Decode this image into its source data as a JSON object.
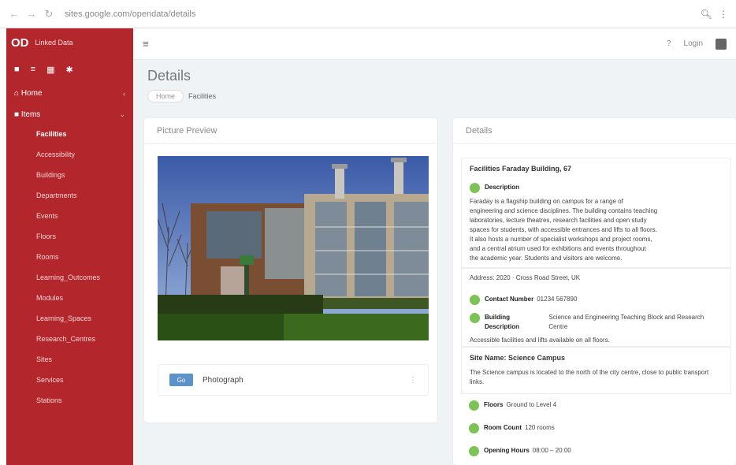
{
  "browser": {
    "url": "sites.google.com/opendata/details",
    "back": "←",
    "forward": "→",
    "reload": "↻",
    "search_icon": "search-icon",
    "menu_icon": "more-icon"
  },
  "brand": {
    "logo": "OD",
    "name": "Linked Data"
  },
  "sidebar": {
    "quick_icons": [
      "home-icon",
      "list-icon",
      "grid-icon",
      "settings-icon"
    ],
    "home_label": "Home",
    "section_label": "Items",
    "items": [
      {
        "label": "Facilities",
        "active": true
      },
      {
        "label": "Accessibility",
        "active": false
      },
      {
        "label": "Buildings",
        "active": false
      },
      {
        "label": "Departments",
        "active": false
      },
      {
        "label": "Events",
        "active": false
      },
      {
        "label": "Floors",
        "active": false
      },
      {
        "label": "Rooms",
        "active": false
      },
      {
        "label": "Learning_Outcomes",
        "active": false
      },
      {
        "label": "Modules",
        "active": false
      },
      {
        "label": "Learning_Spaces",
        "active": false
      },
      {
        "label": "Research_Centres",
        "active": false
      },
      {
        "label": "Sites",
        "active": false
      },
      {
        "label": "Services",
        "active": false
      },
      {
        "label": "Stations",
        "active": false
      }
    ]
  },
  "topbar": {
    "menu_icon": "menu-icon",
    "help_text": "?",
    "login_text": "Login",
    "user_icon": "user-icon"
  },
  "page": {
    "title": "Details",
    "breadcrumb_home": "Home",
    "breadcrumb_current": "Facilities"
  },
  "photo_panel": {
    "heading": "Picture Preview",
    "button_label": "Go",
    "footer_label": "Photograph",
    "more_label": "⋮"
  },
  "details_panel": {
    "heading": "Details",
    "card1": {
      "title": "Facilities Faraday Building, 67",
      "badge_label": "Description",
      "lines": [
        "Faraday is a flagship building on campus for a range of",
        "engineering and science disciplines. The building contains teaching",
        "laboratories, lecture theatres, research facilities and open study",
        "spaces for students, with accessible entrances and lifts to all floors.",
        "It also hosts a number of specialist workshops and project rooms,",
        "and a central atrium used for exhibitions and events throughout",
        "the academic year. Students and visitors are welcome."
      ]
    },
    "card2": {
      "address": "Address: 2020 · Cross Road Street, UK",
      "rows": [
        {
          "label": "Contact Number",
          "text": "01234 567890"
        },
        {
          "label": "Building Description",
          "text": "Science and Engineering Teaching Block and Research Centre"
        }
      ],
      "tail": "Accessible facilities and lifts available on all floors."
    },
    "card3": {
      "title": "Site Name: Science Campus",
      "lines": [
        "The Science campus is located to the north of the city centre, close to public transport",
        "links."
      ]
    },
    "badges": [
      {
        "label": "Floors",
        "text": "Ground to Level 4"
      },
      {
        "label": "Room Count",
        "text": "120 rooms"
      },
      {
        "label": "Opening Hours",
        "text": "08:00 – 20:00"
      }
    ]
  }
}
